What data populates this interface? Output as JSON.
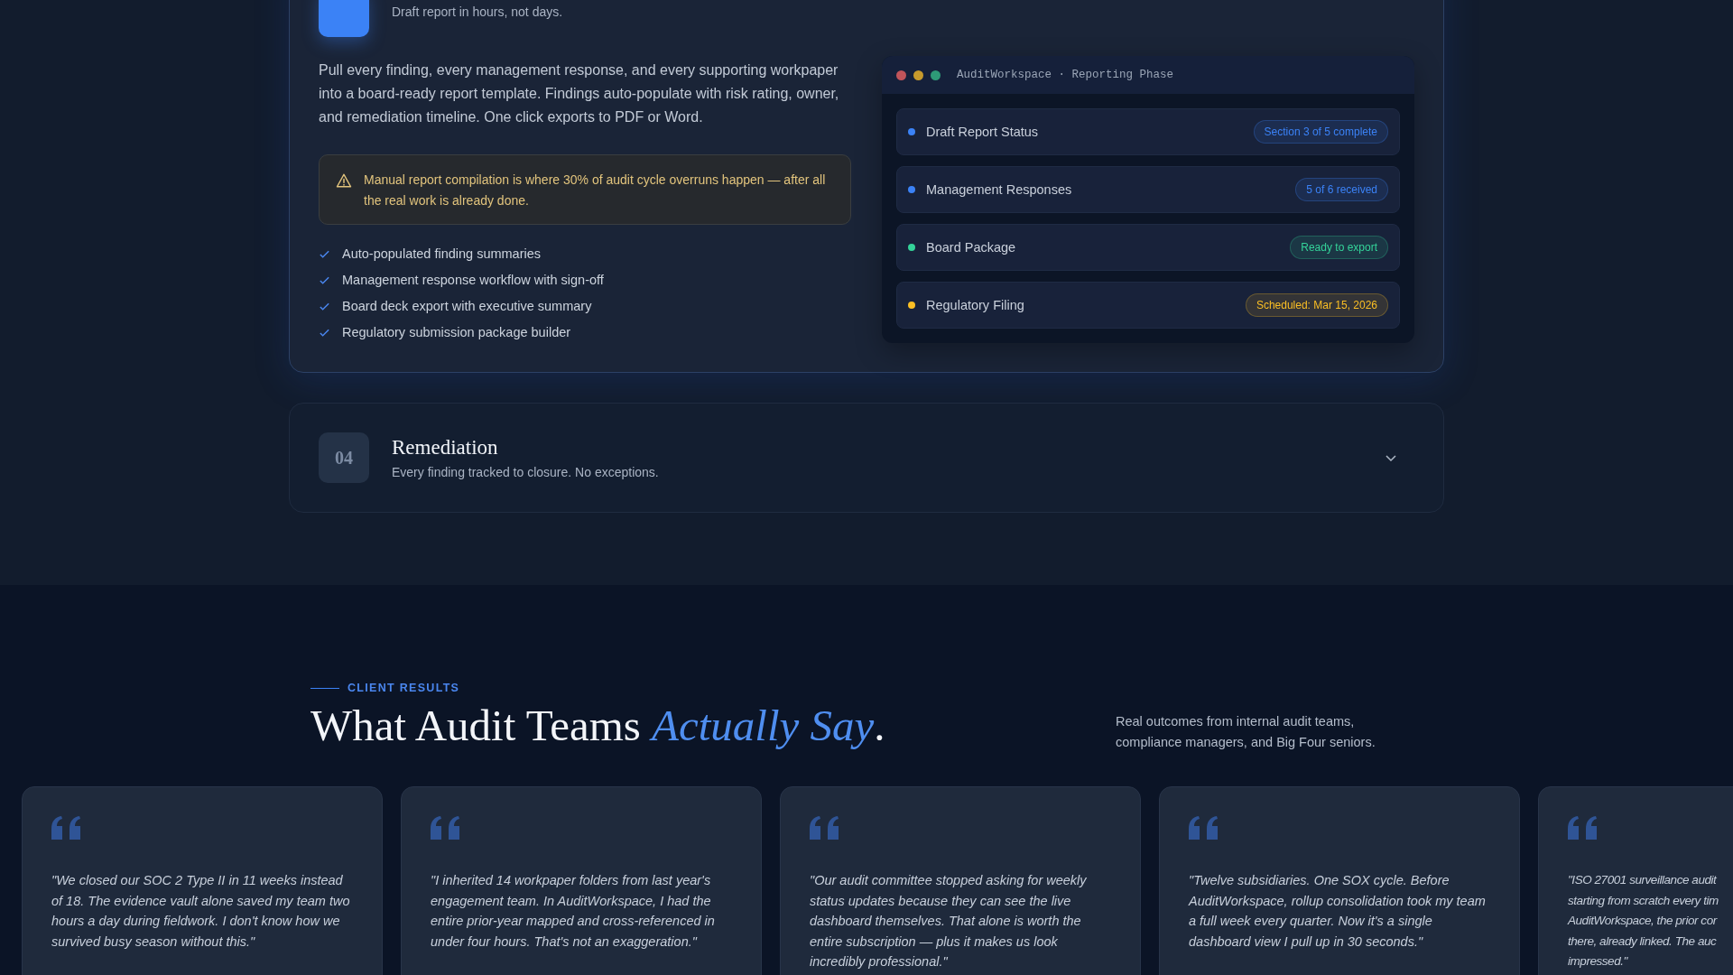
{
  "steps": [
    {
      "expanded": true,
      "subtitle": "Draft report in hours, not days.",
      "description": "Pull every finding, every management response, and every supporting workpaper into a board-ready report template. Findings auto-populate with risk rating, owner, and remediation timeline. One click exports to PDF or Word.",
      "warning": "Manual report compilation is where 30% of audit cycle overruns happen — after all the real work is already done.",
      "features": [
        "Auto-populated finding summaries",
        "Management response workflow with sign-off",
        "Board deck export with executive summary",
        "Regulatory submission package builder"
      ],
      "panel": {
        "title": "AuditWorkspace · Reporting Phase",
        "rows": [
          {
            "label": "Draft Report Status",
            "badge": "Section 3 of 5 complete",
            "color": "#3b82f6"
          },
          {
            "label": "Management Responses",
            "badge": "5 of 6 received",
            "color": "#3b82f6"
          },
          {
            "label": "Board Package",
            "badge": "Ready to export",
            "color": "#34d399"
          },
          {
            "label": "Regulatory Filing",
            "badge": "Scheduled: Mar 15, 2026",
            "color": "#fbbf24"
          }
        ]
      }
    },
    {
      "expanded": false,
      "number": "04",
      "title": "Remediation",
      "subtitle": "Every finding tracked to closure. No exceptions."
    }
  ],
  "results": {
    "eyebrow": "CLIENT RESULTS",
    "heading": "What Audit Teams",
    "heading_accent": "Actually Say",
    "heading_end": ".",
    "intro": "Real outcomes from internal audit teams, compliance managers, and Big Four seniors.",
    "testimonials": [
      {
        "quote": "\"We closed our SOC 2 Type II in 11 weeks instead of 18. The evidence vault alone saved my team two hours a day during fieldwork. I don't know how we survived busy season without this.\""
      },
      {
        "quote": "\"I inherited 14 workpaper folders from last year's engagement team. In AuditWorkspace, I had the entire prior-year mapped and cross-referenced in under four hours. That's not an exaggeration.\""
      },
      {
        "quote": "\"Our audit committee stopped asking for weekly status updates because they can see the live dashboard themselves. That alone is worth the entire subscription — plus it makes us look incredibly professional.\""
      },
      {
        "quote": "\"Twelve subsidiaries. One SOX cycle. Before AuditWorkspace, rollup consolidation took my team a full week every quarter. Now it's a single dashboard view I pull up in 30 seconds.\""
      },
      {
        "quote": "\"ISO 27001 surveillance audit\nstarting from scratch every tim\nAuditWorkspace, the prior cor\nthere, already linked. The auc\nimpressed.\""
      }
    ]
  }
}
